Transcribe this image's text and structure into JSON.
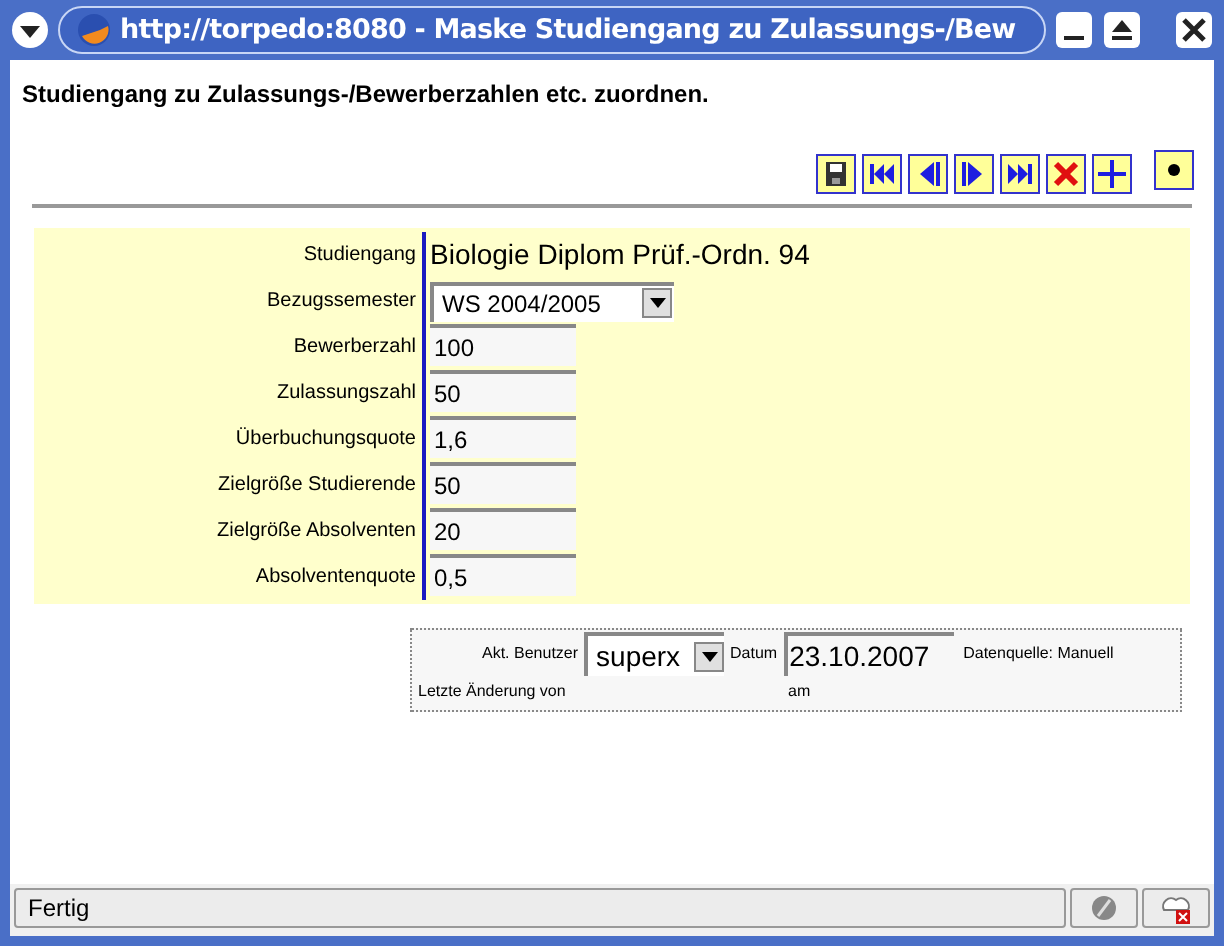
{
  "window": {
    "title": "http://torpedo:8080 - Maske Studiengang zu Zulassungs-/Bew"
  },
  "heading": "Studiengang zu Zulassungs-/Bewerberzahlen etc. zuordnen.",
  "toolbar": [
    {
      "kind": "save"
    },
    {
      "kind": "first"
    },
    {
      "kind": "prev"
    },
    {
      "kind": "next"
    },
    {
      "kind": "last"
    },
    {
      "kind": "delete"
    },
    {
      "kind": "new"
    },
    {
      "kind": "dot"
    }
  ],
  "form": [
    {
      "kind": "text",
      "label": "Studiengang",
      "value": "Biologie Diplom Prüf.-Ordn. 94"
    },
    {
      "kind": "select",
      "label": "Bezugssemester",
      "value": "WS 2004/2005"
    },
    {
      "kind": "input",
      "label": "Bewerberzahl",
      "value": "100"
    },
    {
      "kind": "input",
      "label": "Zulassungszahl",
      "value": "50"
    },
    {
      "kind": "input",
      "label": "Überbuchungsquote",
      "value": "1,6"
    },
    {
      "kind": "input",
      "label": "Zielgröße Studierende",
      "value": "50"
    },
    {
      "kind": "input",
      "label": "Zielgröße Absolventen",
      "value": "20"
    },
    {
      "kind": "input",
      "label": "Absolventenquote",
      "value": "0,5"
    }
  ],
  "footer": {
    "user_label": "Akt. Benutzer",
    "user": "superx",
    "date_label": "Datum",
    "date": "23.10.2007",
    "source": "Datenquelle: Manuell",
    "last_change": "Letzte Änderung von",
    "on": "am"
  },
  "status_bar": "Fertig"
}
